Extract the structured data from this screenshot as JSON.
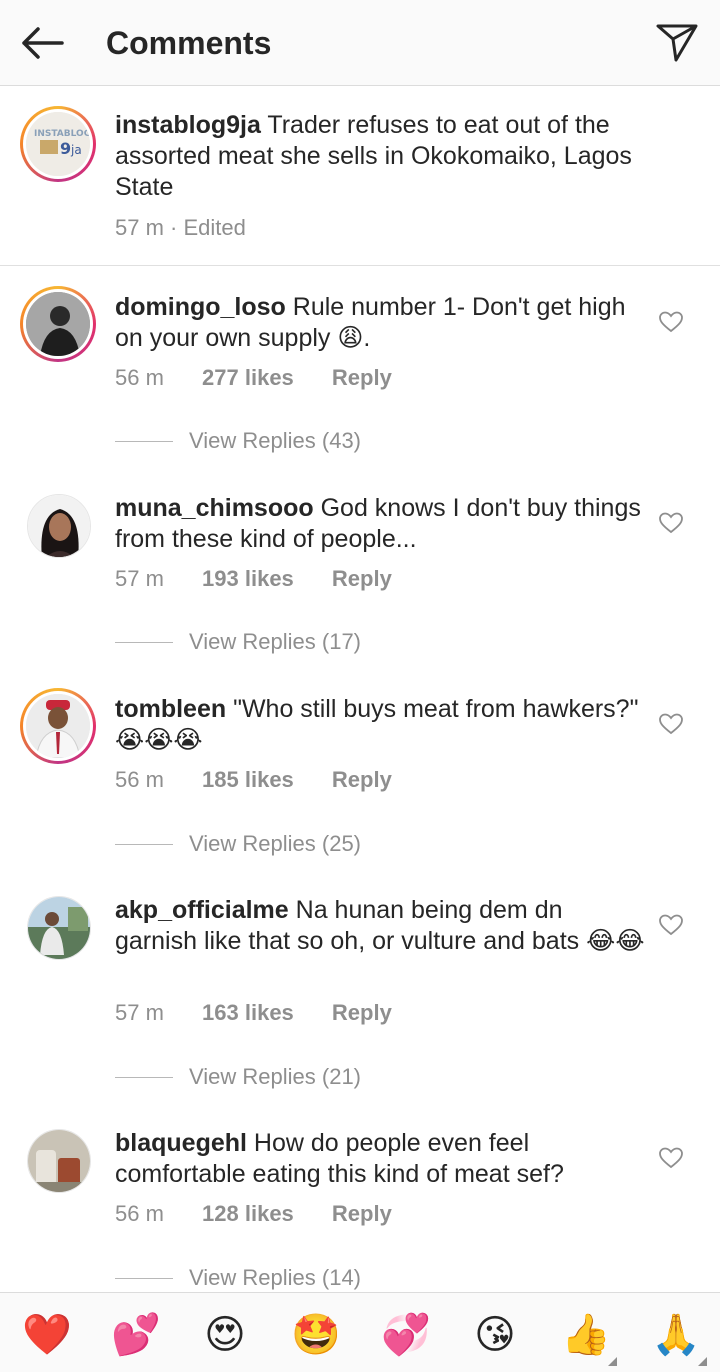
{
  "header": {
    "title": "Comments"
  },
  "caption": {
    "username": "instablog9ja",
    "text": "Trader refuses to eat out of the assorted meat she sells in Okokomaiko, Lagos State",
    "meta": "57 m · Edited"
  },
  "comments": [
    {
      "username": "domingo_loso",
      "text": "Rule number 1- Don't get high on your own supply 😩.",
      "time": "56 m",
      "likes": "277 likes",
      "reply": "Reply",
      "view_replies": "View Replies (43)"
    },
    {
      "username": "muna_chimsooo",
      "text": "God knows I don't buy things from these kind of people...",
      "time": "57 m",
      "likes": "193 likes",
      "reply": "Reply",
      "view_replies": "View Replies (17)"
    },
    {
      "username": "tombleen",
      "text": "\"Who still buys meat from hawkers?\" 😭😭😭",
      "time": "56 m",
      "likes": "185 likes",
      "reply": "Reply",
      "view_replies": "View Replies (25)"
    },
    {
      "username": "akp_officialme",
      "text": "Na hunan being dem dn garnish like that so oh, or vulture and bats 😂😂",
      "time": "57 m",
      "likes": "163 likes",
      "reply": "Reply",
      "view_replies": "View Replies (21)"
    },
    {
      "username": "blaquegehl",
      "text": "How do people even feel comfortable eating this kind of meat sef?",
      "time": "56 m",
      "likes": "128 likes",
      "reply": "Reply",
      "view_replies": "View Replies (14)"
    }
  ],
  "emoji_bar": [
    "❤️",
    "💕",
    "😍",
    "🤩",
    "💞",
    "😘",
    "👍",
    "🙏"
  ],
  "icons": {
    "back": "arrow-left-icon",
    "share": "paper-plane-icon",
    "like": "heart-outline-icon"
  },
  "colors": {
    "secondary_text": "#8e8e8e",
    "primary_text": "#262626",
    "ring_gradient": "#e1306c"
  }
}
